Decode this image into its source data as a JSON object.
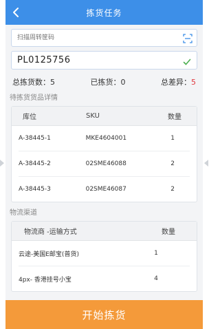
{
  "header": {
    "title": "拣货任务"
  },
  "scan": {
    "placeholder": "扫描周转筐码"
  },
  "task_code": "PL0125756",
  "stats": {
    "total_label": "总拣货数：",
    "total_value": "5",
    "picked_label": "已拣货：",
    "picked_value": "0",
    "diff_label": "总差异：",
    "diff_value": "5"
  },
  "goods_section_label": "待拣货货品详情",
  "goods_table": {
    "headers": {
      "location": "库位",
      "sku": "SKU",
      "qty": "数量"
    },
    "rows": [
      {
        "location": "A-38445-1",
        "sku": "MKE4604001",
        "qty": "1"
      },
      {
        "location": "A-38445-2",
        "sku": "02SME46088",
        "qty": "2"
      },
      {
        "location": "A-38445-3",
        "sku": "02SME46087",
        "qty": "2"
      }
    ]
  },
  "logistics_section_label": "物流渠道",
  "logistics_table": {
    "headers": {
      "carrier": "物流商 -运输方式",
      "qty": "数量"
    },
    "rows": [
      {
        "carrier": "云途-美国E邮宝(普货)",
        "qty": "1"
      },
      {
        "carrier": "4px- 香港挂号小宝",
        "qty": "4"
      }
    ]
  },
  "start_button_label": "开始拣货",
  "colors": {
    "header": "#3d8fe8",
    "start_button": "#f49a3a",
    "diff_value": "#e0383e",
    "check": "#4caf50"
  }
}
